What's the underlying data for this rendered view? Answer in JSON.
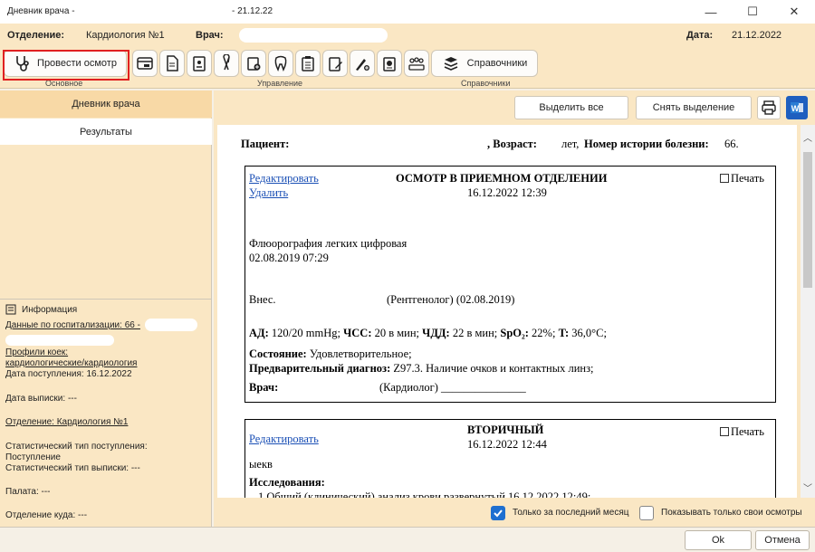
{
  "window": {
    "title_left": "Дневник врача -",
    "title_date": "- 21.12.22",
    "minimize": "—",
    "maximize": "☐",
    "close": "✕"
  },
  "header": {
    "department_label": "Отделение:",
    "department_value": "Кардиология №1",
    "doctor_label": "Врач:",
    "date_label": "Дата:",
    "date_value": "21.12.2022"
  },
  "toolbar": {
    "exam_button": "Провести осмотр",
    "references_button": "Справочники",
    "group_main": "Основное",
    "group_manage": "Управление",
    "group_refs": "Справочники"
  },
  "left": {
    "tab_diary": "Дневник врача",
    "tab_results": "Результаты",
    "info_title": "Информация",
    "hosp_data": "Данные по госпитализации: 66 -",
    "bed_profiles_label": "Профили коек:",
    "bed_profiles_value": "кардиологические/кардиология",
    "admission_date": "Дата поступления: 16.12.2022",
    "discharge_date": "Дата выписки: ---",
    "department": "Отделение: Кардиология №1",
    "stat_admission_label": "Статистический тип поступления:",
    "stat_admission_value": "Поступление",
    "stat_discharge": "Статистический тип выписки: ---",
    "ward": "Палата: ---",
    "dest_department": "Отделение куда: ---"
  },
  "right": {
    "select_all": "Выделить все",
    "deselect": "Снять выделение",
    "only_last_month": "Только за последний месяц",
    "only_mine": "Показывать только свои осмотры",
    "only_last_month_checked": true,
    "only_mine_checked": false
  },
  "document": {
    "patient_label": "Пациент:",
    "age_label": ", Возраст:",
    "age_suffix": "лет,",
    "history_label": "Номер истории болезни:",
    "history_value": "66.",
    "card1": {
      "edit": "Редактировать",
      "delete": "Удалить",
      "title": "ОСМОТР В ПРИЕМНОМ ОТДЕЛЕНИИ",
      "datetime": "16.12.2022 12:39",
      "print": "Печать",
      "study": "Флюорография легких цифровая",
      "study_date": "02.08.2019 07:29",
      "entered": "Внес.",
      "radiologist": "(Рентгенолог) (02.08.2019)",
      "vitals_ad_label": "АД:",
      "vitals_ad": "120/20 mmHg;",
      "vitals_hr_label": "ЧСС:",
      "vitals_hr": "20 в мин;",
      "vitals_rr_label": "ЧДД:",
      "vitals_rr": "22 в мин;",
      "vitals_spo2_label": "SpO₂:",
      "vitals_spo2": "22%;",
      "vitals_t_label": "T:",
      "vitals_t": "36,0°C;",
      "state_label": "Состояние:",
      "state_value": "Удовлетворительное;",
      "diag_label": "Предварительный диагноз:",
      "diag_value": "Z97.3. Наличие очков и контактных линз;",
      "doctor_label": "Врач:",
      "doctor_value": "(Кардиолог) _______________"
    },
    "card2": {
      "edit": "Редактировать",
      "title": "ВТОРИЧНЫЙ",
      "datetime": "16.12.2022 12:44",
      "print": "Печать",
      "text": "ыекв",
      "research_label": "Исследования:",
      "research_item": "1.Общий (клинический) анализ крови развернутый 16.12.2022 12:49;"
    }
  },
  "bottom": {
    "ok": "Ok",
    "cancel": "Отмена"
  },
  "colors": {
    "panel_bg": "#fae7c4",
    "active_tab": "#f8d9a6",
    "highlight": "#e02020",
    "checkbox_on": "#1e6fd0",
    "link": "#1a4fb5"
  }
}
